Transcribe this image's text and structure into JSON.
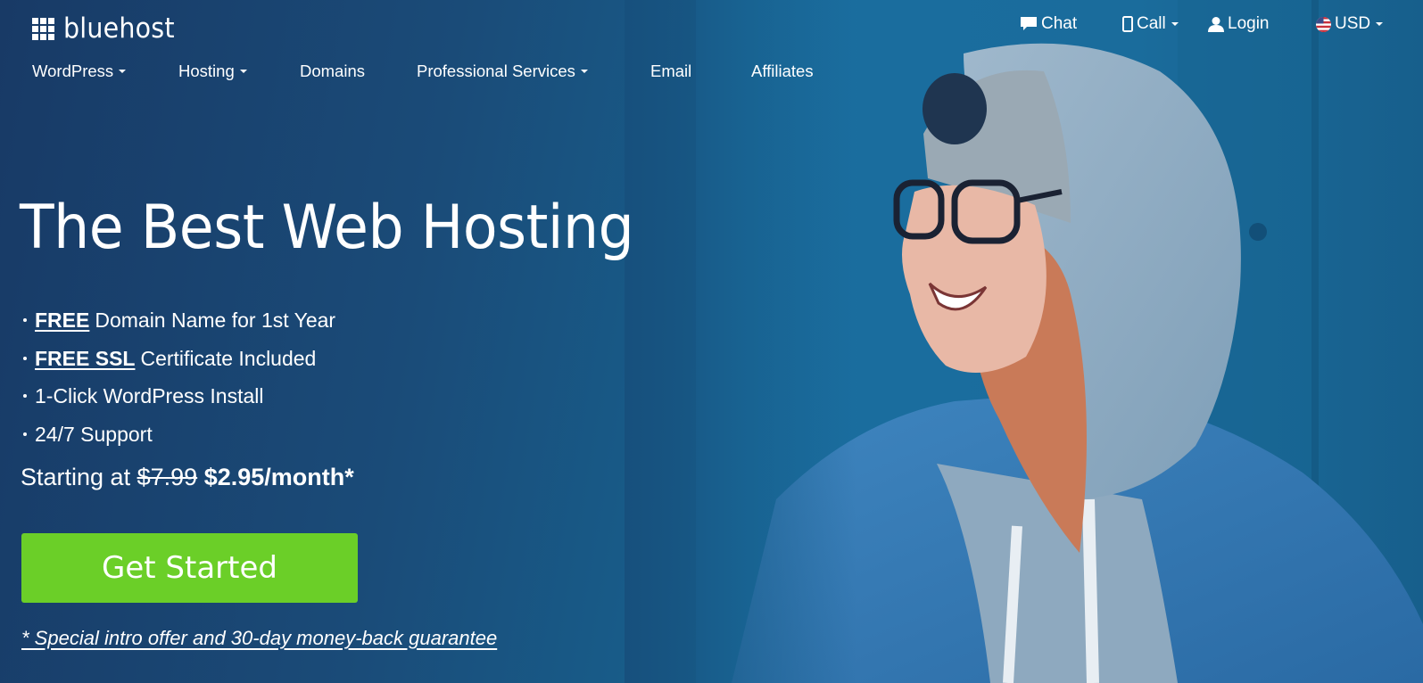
{
  "brand": {
    "name": "bluehost",
    "icon": "grid-logo-icon"
  },
  "utility_nav": [
    {
      "label": "Chat",
      "icon": "chat-bubble-icon",
      "dropdown": false
    },
    {
      "label": "Call",
      "icon": "phone-icon",
      "dropdown": true
    },
    {
      "label": "Login",
      "icon": "user-icon",
      "dropdown": false
    },
    {
      "label": "USD",
      "icon": "us-flag-icon",
      "dropdown": true
    }
  ],
  "main_nav": [
    {
      "label": "WordPress",
      "dropdown": true
    },
    {
      "label": "Hosting",
      "dropdown": true
    },
    {
      "label": "Domains",
      "dropdown": false
    },
    {
      "label": "Professional Services",
      "dropdown": true
    },
    {
      "label": "Email",
      "dropdown": false
    },
    {
      "label": "Affiliates",
      "dropdown": false
    }
  ],
  "hero": {
    "title": "The Best Web Hosting",
    "features": [
      {
        "emphasis": "FREE",
        "text": "Domain Name for 1st Year"
      },
      {
        "emphasis": "FREE SSL",
        "text": "Certificate Included"
      },
      {
        "emphasis": "",
        "text": "1-Click WordPress Install"
      },
      {
        "emphasis": "",
        "text": "24/7 Support"
      }
    ],
    "price": {
      "prefix": "Starting at",
      "old_price": "$7.99",
      "new_price": "$2.95/month*"
    },
    "cta_label": "Get Started",
    "disclaimer": "* Special intro offer and 30-day money-back guarantee",
    "image_alt": "Smiling woman in glasses, hoodie and denim jacket"
  },
  "colors": {
    "cta_green": "#6bcf28",
    "bg_dark_blue": "#183a66",
    "bg_teal_blue": "#1671a0"
  }
}
